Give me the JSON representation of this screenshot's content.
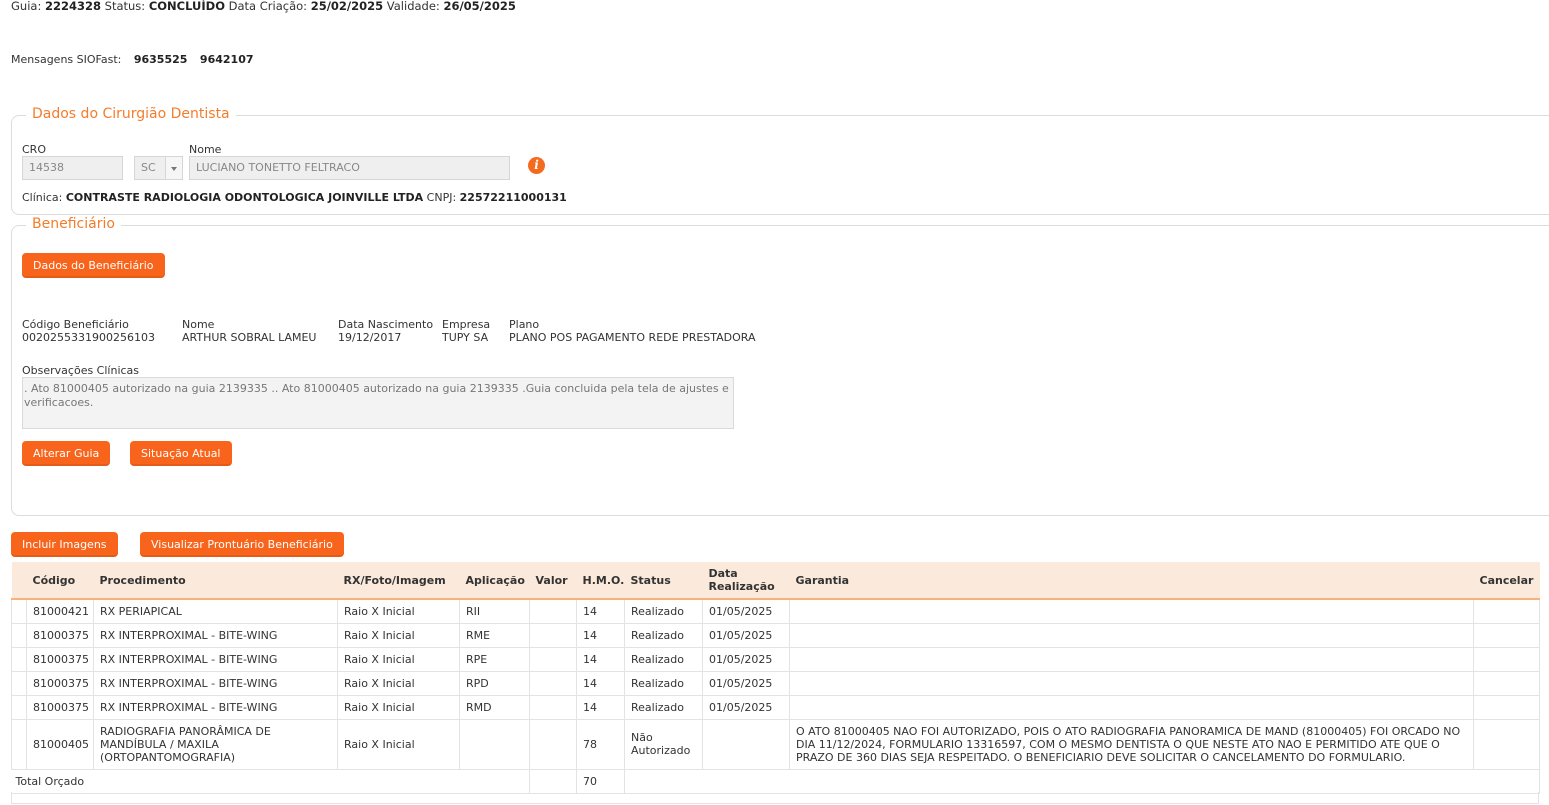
{
  "header": {
    "guia_label": "Guia:",
    "guia": "2224328",
    "status_label": "Status:",
    "status": "CONCLUÍDO",
    "criacao_label": "Data Criação:",
    "criacao": "25/02/2025",
    "validade_label": "Validade:",
    "validade": "26/05/2025"
  },
  "mensagens": {
    "label": "Mensagens SIOFast:",
    "items": [
      "9635525",
      "9642107"
    ]
  },
  "dentista": {
    "legend": "Dados do Cirurgião Dentista",
    "cro_label": "CRO",
    "cro": "14538",
    "uf": "SC",
    "nome_label": "Nome",
    "nome": "LUCIANO TONETTO FELTRACO",
    "info_icon": "info-icon",
    "clinica_label": "Clínica:",
    "clinica": "CONTRASTE RADIOLOGIA ODONTOLOGICA JOINVILLE LTDA",
    "cnpj_label": "CNPJ:",
    "cnpj": "22572211000131"
  },
  "beneficiario": {
    "legend": "Beneficiário",
    "dados_button": "Dados do Beneficiário",
    "codigo_label": "Código Beneficiário",
    "codigo": "0020255331900256103",
    "nome_label": "Nome",
    "nome": "ARTHUR SOBRAL LAMEU",
    "nascimento_label": "Data Nascimento",
    "nascimento": "19/12/2017",
    "empresa_label": "Empresa",
    "empresa": "TUPY SA",
    "plano_label": "Plano",
    "plano": "PLANO POS PAGAMENTO REDE PRESTADORA",
    "obs_label": "Observações Clínicas",
    "obs": ". Ato 81000405 autorizado na guia 2139335 .. Ato 81000405 autorizado na guia 2139335 .Guia concluida pela tela de ajustes e verificacoes.",
    "alterar_button": "Alterar Guia",
    "situacao_button": "Situação Atual"
  },
  "actions": {
    "incluir_imagens": "Incluir Imagens",
    "visualizar_prontuario": "Visualizar Prontuário Beneficiário"
  },
  "table": {
    "headers": {
      "codigo": "Código",
      "procedimento": "Procedimento",
      "rx": "RX/Foto/Imagem",
      "aplicacao": "Aplicação",
      "valor": "Valor",
      "hmo": "H.M.O.",
      "status": "Status",
      "data1": "Data",
      "data2": "Realização",
      "garantia": "Garantia",
      "cancelar": "Cancelar"
    },
    "rows": [
      {
        "codigo": "81000421",
        "procedimento": "RX PERIAPICAL",
        "rx": "Raio X Inicial",
        "aplicacao": "RII",
        "valor": "",
        "hmo": "14",
        "status": "Realizado",
        "data": "01/05/2025",
        "garantia": ""
      },
      {
        "codigo": "81000375",
        "procedimento": "RX INTERPROXIMAL - BITE-WING",
        "rx": "Raio X Inicial",
        "aplicacao": "RME",
        "valor": "",
        "hmo": "14",
        "status": "Realizado",
        "data": "01/05/2025",
        "garantia": ""
      },
      {
        "codigo": "81000375",
        "procedimento": "RX INTERPROXIMAL - BITE-WING",
        "rx": "Raio X Inicial",
        "aplicacao": "RPE",
        "valor": "",
        "hmo": "14",
        "status": "Realizado",
        "data": "01/05/2025",
        "garantia": ""
      },
      {
        "codigo": "81000375",
        "procedimento": "RX INTERPROXIMAL - BITE-WING",
        "rx": "Raio X Inicial",
        "aplicacao": "RPD",
        "valor": "",
        "hmo": "14",
        "status": "Realizado",
        "data": "01/05/2025",
        "garantia": ""
      },
      {
        "codigo": "81000375",
        "procedimento": "RX INTERPROXIMAL - BITE-WING",
        "rx": "Raio X Inicial",
        "aplicacao": "RMD",
        "valor": "",
        "hmo": "14",
        "status": "Realizado",
        "data": "01/05/2025",
        "garantia": ""
      },
      {
        "codigo": "81000405",
        "procedimento": "RADIOGRAFIA PANORÂMICA DE MANDÍBULA / MAXILA (ORTOPANTOMOGRAFIA)",
        "rx": "Raio X Inicial",
        "aplicacao": "",
        "valor": "",
        "hmo": "78",
        "status": "Não Autorizado",
        "data": "",
        "garantia": "O ATO 81000405 NAO FOI AUTORIZADO, POIS O ATO RADIOGRAFIA PANORAMICA DE MAND (81000405) FOI ORCADO NO DIA 11/12/2024, FORMULARIO 13316597, COM O MESMO DENTISTA O QUE NESTE ATO NAO E PERMITIDO ATE QUE O PRAZO DE 360 DIAS SEJA RESPEITADO. O BENEFICIARIO DEVE SOLICITAR O CANCELAMENTO DO FORMULARIO."
      }
    ],
    "total_label": "Total Orçado",
    "total_hmo": "70"
  }
}
